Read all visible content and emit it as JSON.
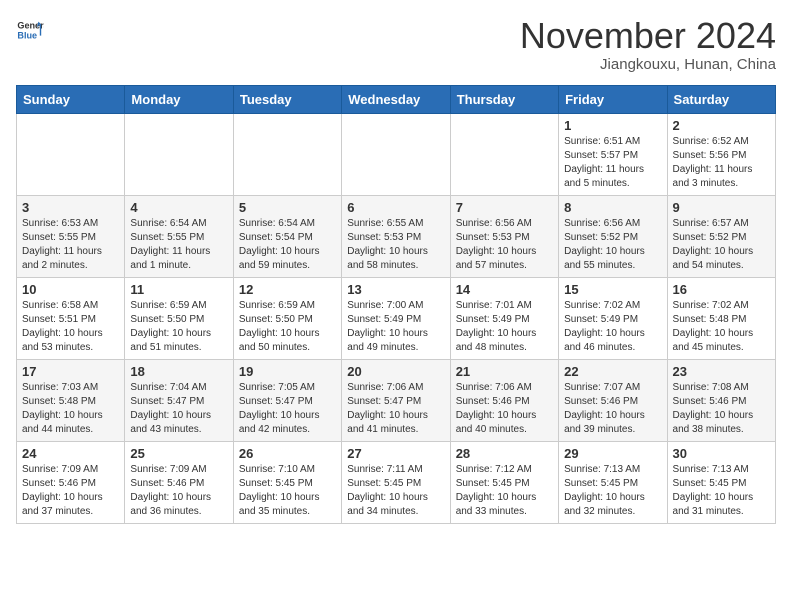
{
  "header": {
    "logo": {
      "general": "General",
      "blue": "Blue",
      "icon_title": "GeneralBlue logo"
    },
    "title": "November 2024",
    "location": "Jiangkouxu, Hunan, China"
  },
  "calendar": {
    "weekdays": [
      "Sunday",
      "Monday",
      "Tuesday",
      "Wednesday",
      "Thursday",
      "Friday",
      "Saturday"
    ],
    "weeks": [
      [
        {
          "day": "",
          "info": ""
        },
        {
          "day": "",
          "info": ""
        },
        {
          "day": "",
          "info": ""
        },
        {
          "day": "",
          "info": ""
        },
        {
          "day": "",
          "info": ""
        },
        {
          "day": "1",
          "info": "Sunrise: 6:51 AM\nSunset: 5:57 PM\nDaylight: 11 hours\nand 5 minutes."
        },
        {
          "day": "2",
          "info": "Sunrise: 6:52 AM\nSunset: 5:56 PM\nDaylight: 11 hours\nand 3 minutes."
        }
      ],
      [
        {
          "day": "3",
          "info": "Sunrise: 6:53 AM\nSunset: 5:55 PM\nDaylight: 11 hours\nand 2 minutes."
        },
        {
          "day": "4",
          "info": "Sunrise: 6:54 AM\nSunset: 5:55 PM\nDaylight: 11 hours\nand 1 minute."
        },
        {
          "day": "5",
          "info": "Sunrise: 6:54 AM\nSunset: 5:54 PM\nDaylight: 10 hours\nand 59 minutes."
        },
        {
          "day": "6",
          "info": "Sunrise: 6:55 AM\nSunset: 5:53 PM\nDaylight: 10 hours\nand 58 minutes."
        },
        {
          "day": "7",
          "info": "Sunrise: 6:56 AM\nSunset: 5:53 PM\nDaylight: 10 hours\nand 57 minutes."
        },
        {
          "day": "8",
          "info": "Sunrise: 6:56 AM\nSunset: 5:52 PM\nDaylight: 10 hours\nand 55 minutes."
        },
        {
          "day": "9",
          "info": "Sunrise: 6:57 AM\nSunset: 5:52 PM\nDaylight: 10 hours\nand 54 minutes."
        }
      ],
      [
        {
          "day": "10",
          "info": "Sunrise: 6:58 AM\nSunset: 5:51 PM\nDaylight: 10 hours\nand 53 minutes."
        },
        {
          "day": "11",
          "info": "Sunrise: 6:59 AM\nSunset: 5:50 PM\nDaylight: 10 hours\nand 51 minutes."
        },
        {
          "day": "12",
          "info": "Sunrise: 6:59 AM\nSunset: 5:50 PM\nDaylight: 10 hours\nand 50 minutes."
        },
        {
          "day": "13",
          "info": "Sunrise: 7:00 AM\nSunset: 5:49 PM\nDaylight: 10 hours\nand 49 minutes."
        },
        {
          "day": "14",
          "info": "Sunrise: 7:01 AM\nSunset: 5:49 PM\nDaylight: 10 hours\nand 48 minutes."
        },
        {
          "day": "15",
          "info": "Sunrise: 7:02 AM\nSunset: 5:49 PM\nDaylight: 10 hours\nand 46 minutes."
        },
        {
          "day": "16",
          "info": "Sunrise: 7:02 AM\nSunset: 5:48 PM\nDaylight: 10 hours\nand 45 minutes."
        }
      ],
      [
        {
          "day": "17",
          "info": "Sunrise: 7:03 AM\nSunset: 5:48 PM\nDaylight: 10 hours\nand 44 minutes."
        },
        {
          "day": "18",
          "info": "Sunrise: 7:04 AM\nSunset: 5:47 PM\nDaylight: 10 hours\nand 43 minutes."
        },
        {
          "day": "19",
          "info": "Sunrise: 7:05 AM\nSunset: 5:47 PM\nDaylight: 10 hours\nand 42 minutes."
        },
        {
          "day": "20",
          "info": "Sunrise: 7:06 AM\nSunset: 5:47 PM\nDaylight: 10 hours\nand 41 minutes."
        },
        {
          "day": "21",
          "info": "Sunrise: 7:06 AM\nSunset: 5:46 PM\nDaylight: 10 hours\nand 40 minutes."
        },
        {
          "day": "22",
          "info": "Sunrise: 7:07 AM\nSunset: 5:46 PM\nDaylight: 10 hours\nand 39 minutes."
        },
        {
          "day": "23",
          "info": "Sunrise: 7:08 AM\nSunset: 5:46 PM\nDaylight: 10 hours\nand 38 minutes."
        }
      ],
      [
        {
          "day": "24",
          "info": "Sunrise: 7:09 AM\nSunset: 5:46 PM\nDaylight: 10 hours\nand 37 minutes."
        },
        {
          "day": "25",
          "info": "Sunrise: 7:09 AM\nSunset: 5:46 PM\nDaylight: 10 hours\nand 36 minutes."
        },
        {
          "day": "26",
          "info": "Sunrise: 7:10 AM\nSunset: 5:45 PM\nDaylight: 10 hours\nand 35 minutes."
        },
        {
          "day": "27",
          "info": "Sunrise: 7:11 AM\nSunset: 5:45 PM\nDaylight: 10 hours\nand 34 minutes."
        },
        {
          "day": "28",
          "info": "Sunrise: 7:12 AM\nSunset: 5:45 PM\nDaylight: 10 hours\nand 33 minutes."
        },
        {
          "day": "29",
          "info": "Sunrise: 7:13 AM\nSunset: 5:45 PM\nDaylight: 10 hours\nand 32 minutes."
        },
        {
          "day": "30",
          "info": "Sunrise: 7:13 AM\nSunset: 5:45 PM\nDaylight: 10 hours\nand 31 minutes."
        }
      ]
    ]
  }
}
